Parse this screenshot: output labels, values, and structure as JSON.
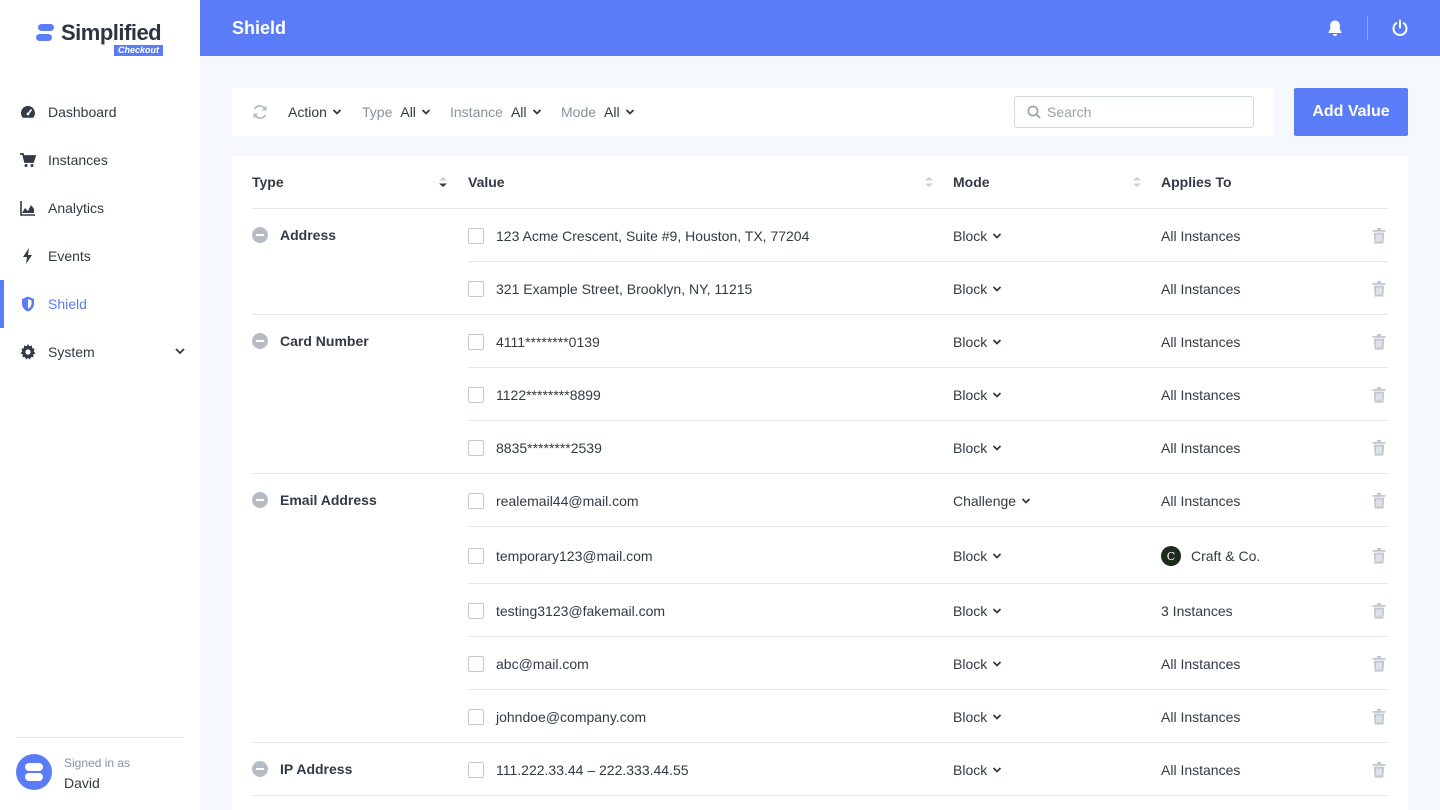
{
  "brand": {
    "name": "Simplified",
    "sub": "Checkout"
  },
  "nav": [
    {
      "label": "Dashboard",
      "icon": "dashboard-gauge-icon"
    },
    {
      "label": "Instances",
      "icon": "cart-icon"
    },
    {
      "label": "Analytics",
      "icon": "area-chart-icon"
    },
    {
      "label": "Events",
      "icon": "bolt-icon"
    },
    {
      "label": "Shield",
      "icon": "shield-icon",
      "active": true
    },
    {
      "label": "System",
      "icon": "gear-icon",
      "expandable": true
    }
  ],
  "user": {
    "signed_label": "Signed in as",
    "name": "David"
  },
  "header": {
    "title": "Shield"
  },
  "toolbar": {
    "action": {
      "value": "Action"
    },
    "type": {
      "label": "Type",
      "value": "All"
    },
    "instance": {
      "label": "Instance",
      "value": "All"
    },
    "mode": {
      "label": "Mode",
      "value": "All"
    },
    "search_placeholder": "Search",
    "search_value": "",
    "add_label": "Add Value"
  },
  "table": {
    "columns": {
      "type": "Type",
      "value": "Value",
      "mode": "Mode",
      "applies": "Applies To"
    },
    "groups": [
      {
        "type": "Address",
        "rows": [
          {
            "value": "123 Acme Crescent, Suite #9, Houston, TX, 77204",
            "mode": "Block",
            "applies": "All Instances"
          },
          {
            "value": "321 Example Street, Brooklyn, NY, 11215",
            "mode": "Block",
            "applies": "All Instances"
          }
        ]
      },
      {
        "type": "Card Number",
        "rows": [
          {
            "value": "4111********0139",
            "mode": "Block",
            "applies": "All Instances"
          },
          {
            "value": "1122********8899",
            "mode": "Block",
            "applies": "All Instances"
          },
          {
            "value": "8835********2539",
            "mode": "Block",
            "applies": "All Instances"
          }
        ]
      },
      {
        "type": "Email Address",
        "rows": [
          {
            "value": "realemail44@mail.com",
            "mode": "Challenge",
            "applies": "All Instances"
          },
          {
            "value": "temporary123@mail.com",
            "mode": "Block",
            "applies": "Craft & Co.",
            "badge": "C"
          },
          {
            "value": "testing3123@fakemail.com",
            "mode": "Block",
            "applies": "3 Instances"
          },
          {
            "value": "abc@mail.com",
            "mode": "Block",
            "applies": "All Instances"
          },
          {
            "value": "johndoe@company.com",
            "mode": "Block",
            "applies": "All Instances"
          }
        ]
      },
      {
        "type": "IP Address",
        "rows": [
          {
            "value": "111.222.33.44 – 222.333.44.55",
            "mode": "Block",
            "applies": "All Instances"
          }
        ]
      }
    ]
  },
  "colors": {
    "accent": "#5b7cf9",
    "background": "#f5f8fc",
    "text": "#333a45",
    "muted": "#8a919c"
  }
}
